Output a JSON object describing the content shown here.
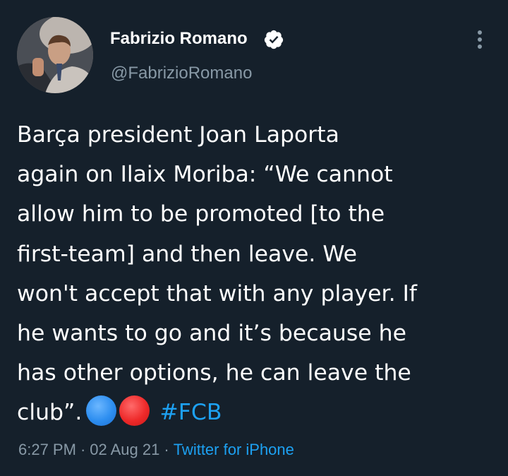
{
  "author": {
    "name": "Fabrizio Romano",
    "handle": "@FabrizioRomano",
    "verified": true
  },
  "tweet": {
    "lines": [
      "Barça president Joan Laporta",
      "again on Ilaix Moriba: “We cannot",
      "allow him to be promoted [to the",
      "first-team] and then leave. We",
      "won't accept that with any player. If",
      "he wants to go and it’s because he",
      "has other options, he can leave the"
    ],
    "last_line_text": "club”.",
    "hashtag": "#FCB"
  },
  "meta": {
    "time": "6:27 PM",
    "date": "02 Aug 21",
    "separator": "·",
    "source": "Twitter for iPhone"
  },
  "icons": {
    "verified": "verified-badge-icon",
    "more": "more-vertical-icon",
    "emoji_1": "blue-circle-emoji",
    "emoji_2": "red-circle-emoji"
  },
  "colors": {
    "background": "#15202b",
    "text": "#ffffff",
    "secondary": "#8899a6",
    "link": "#1da1f2"
  }
}
